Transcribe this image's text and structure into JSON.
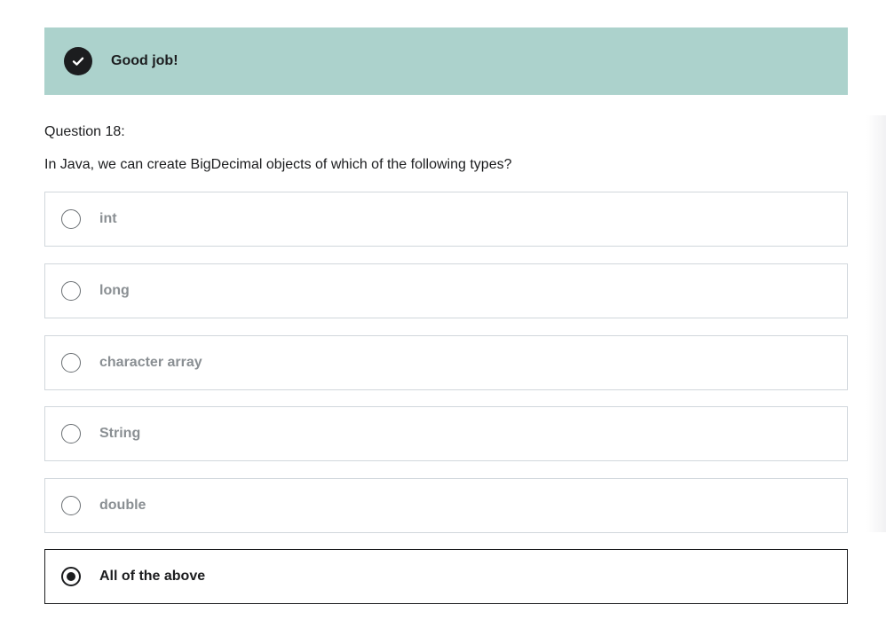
{
  "feedback": {
    "icon": "check-circle-icon",
    "message": "Good job!",
    "background_color": "#acd2cc"
  },
  "question": {
    "label": "Question 18:",
    "text": "In Java, we can create BigDecimal objects of which of the following types?"
  },
  "options": [
    {
      "label": "int",
      "selected": false
    },
    {
      "label": "long",
      "selected": false
    },
    {
      "label": "character array",
      "selected": false
    },
    {
      "label": "String",
      "selected": false
    },
    {
      "label": "double",
      "selected": false
    },
    {
      "label": "All of the above",
      "selected": true
    }
  ]
}
